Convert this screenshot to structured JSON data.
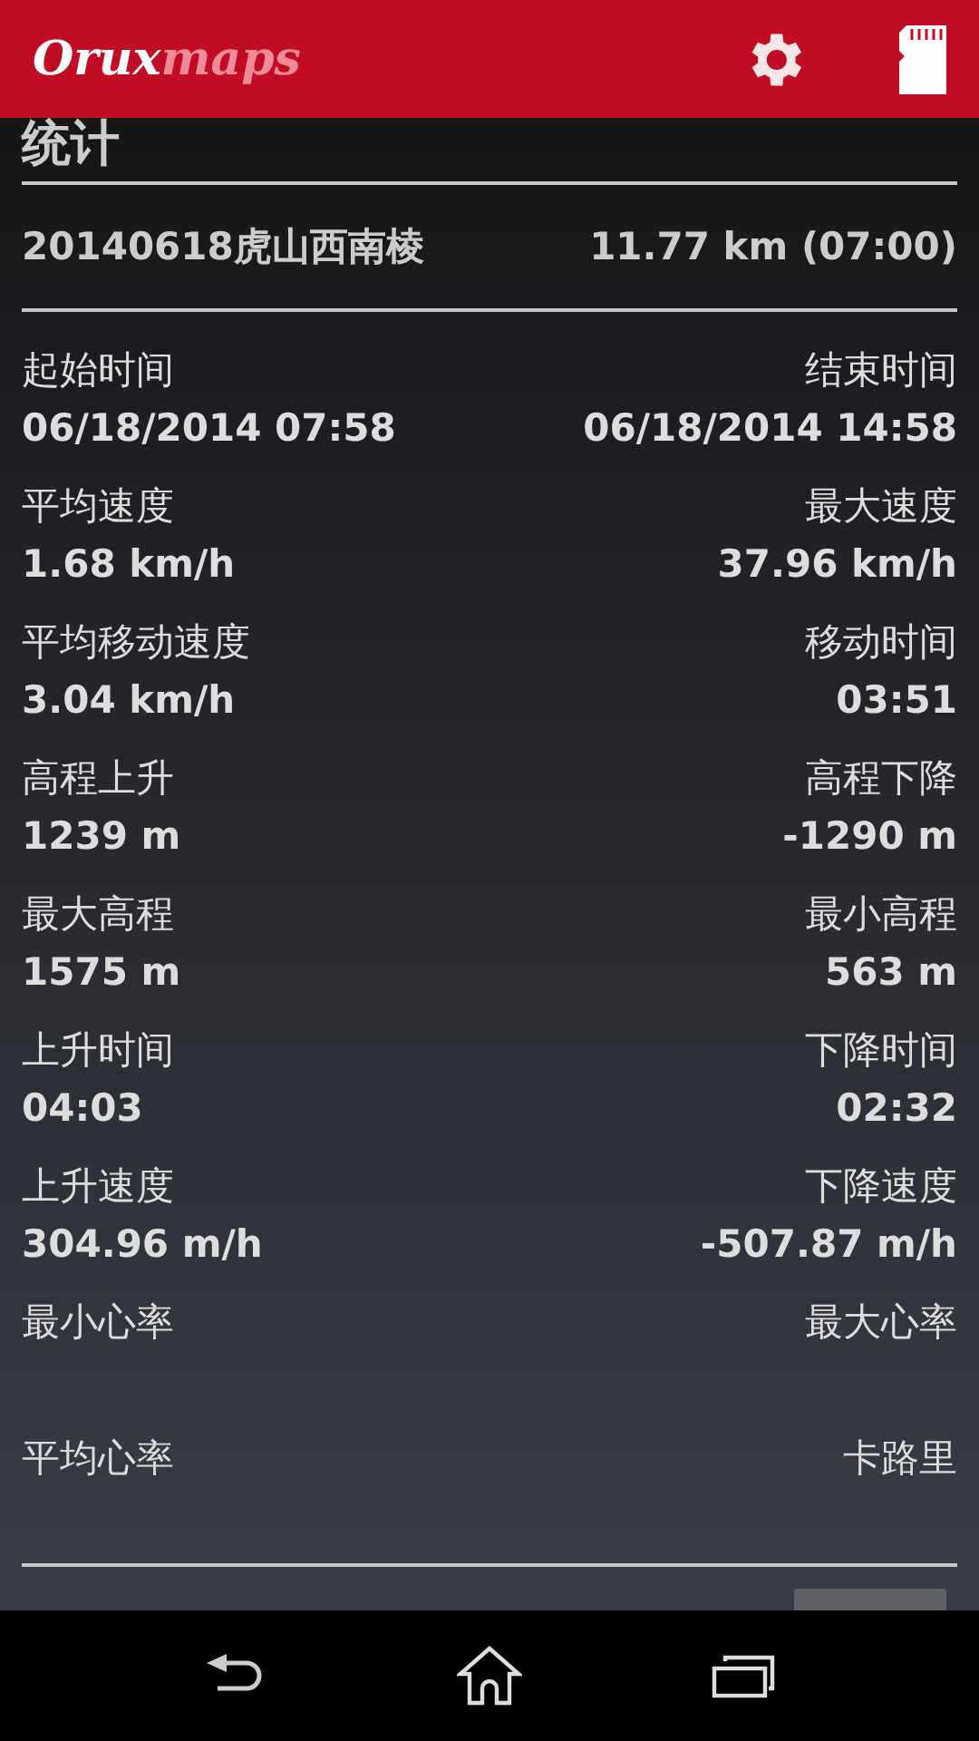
{
  "app_bar": {
    "logo_primary": "Orux",
    "logo_secondary": "maps"
  },
  "section_title": "统计",
  "track": {
    "name": "20140618虎山西南棱",
    "summary": "11.77 km (07:00)"
  },
  "stats": [
    {
      "left_label": "起始时间",
      "left_value": "06/18/2014 07:58",
      "right_label": "结束时间",
      "right_value": "06/18/2014 14:58"
    },
    {
      "left_label": "平均速度",
      "left_value": "1.68 km/h",
      "right_label": "最大速度",
      "right_value": "37.96 km/h"
    },
    {
      "left_label": "平均移动速度",
      "left_value": "3.04 km/h",
      "right_label": "移动时间",
      "right_value": "03:51"
    },
    {
      "left_label": "高程上升",
      "left_value": "1239 m",
      "right_label": "高程下降",
      "right_value": "-1290 m"
    },
    {
      "left_label": "最大高程",
      "left_value": "1575 m",
      "right_label": "最小高程",
      "right_value": "563 m"
    },
    {
      "left_label": "上升时间",
      "left_value": "04:03",
      "right_label": "下降时间",
      "right_value": "02:32"
    },
    {
      "left_label": "上升速度",
      "left_value": "304.96 m/h",
      "right_label": "下降速度",
      "right_value": "-507.87 m/h"
    },
    {
      "left_label": "最小心率",
      "right_label": "最大心率"
    },
    {
      "left_label": "平均心率",
      "right_label": "卡路里"
    }
  ]
}
